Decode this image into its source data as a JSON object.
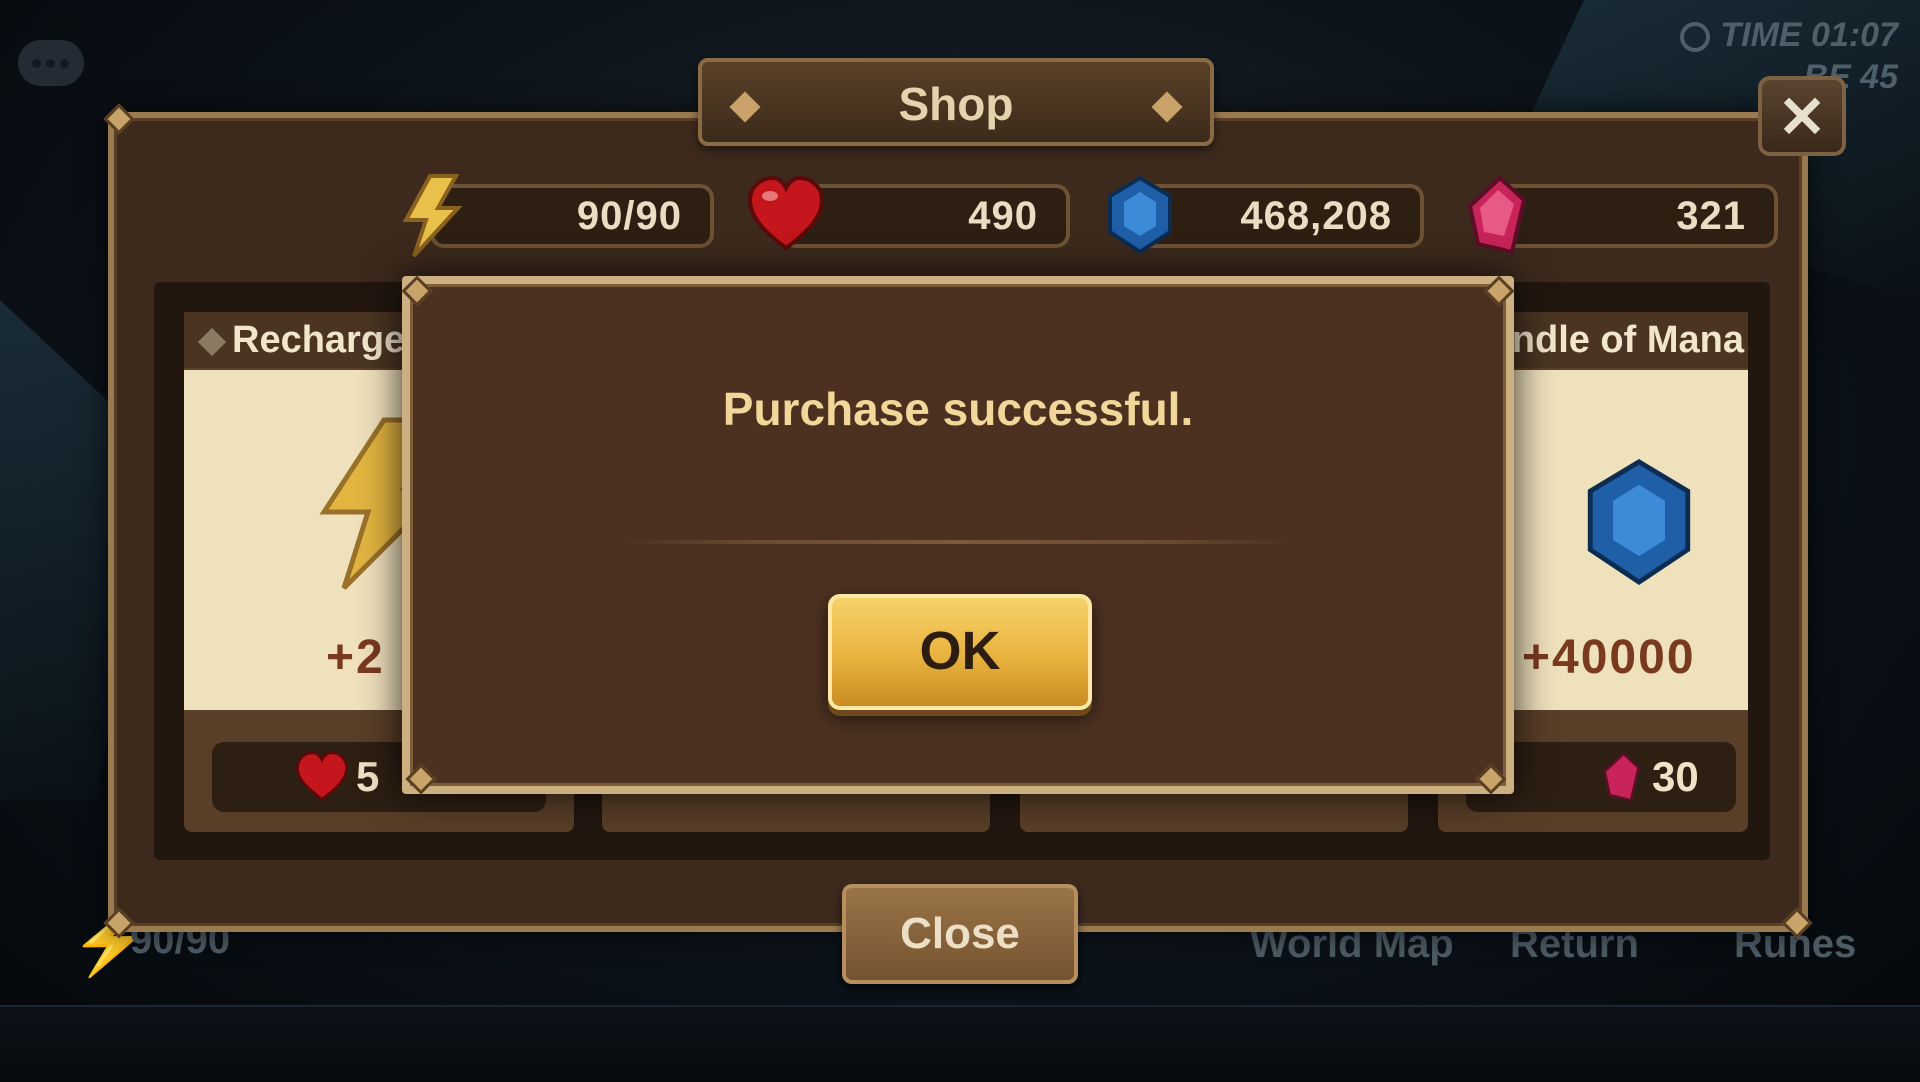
{
  "hud": {
    "time_label": "TIME",
    "time_value": "01:07",
    "second_label": "BE",
    "second_value": "45"
  },
  "shop": {
    "title": "Shop",
    "close_x": "✕",
    "currencies": {
      "energy": "90/90",
      "hearts": "490",
      "mana": "468,208",
      "crystals": "321"
    },
    "cards": [
      {
        "title": "Recharge",
        "amount": "+2",
        "price": "5"
      },
      {
        "title": "Bundle of Mana",
        "amount": "+40000",
        "price": "30"
      }
    ],
    "close_button": "Close"
  },
  "modal": {
    "message": "Purchase successful.",
    "ok_label": "OK"
  },
  "background": {
    "energy": "90/90",
    "world_map": "World Map",
    "return": "Return",
    "runes": "Runes"
  },
  "colors": {
    "panel_brown": "#3d2a1d",
    "modal_brown": "#4c3121",
    "gold_button": "#e8b23e",
    "frame_gold": "#cdb082",
    "message_text": "#f2d79a"
  }
}
